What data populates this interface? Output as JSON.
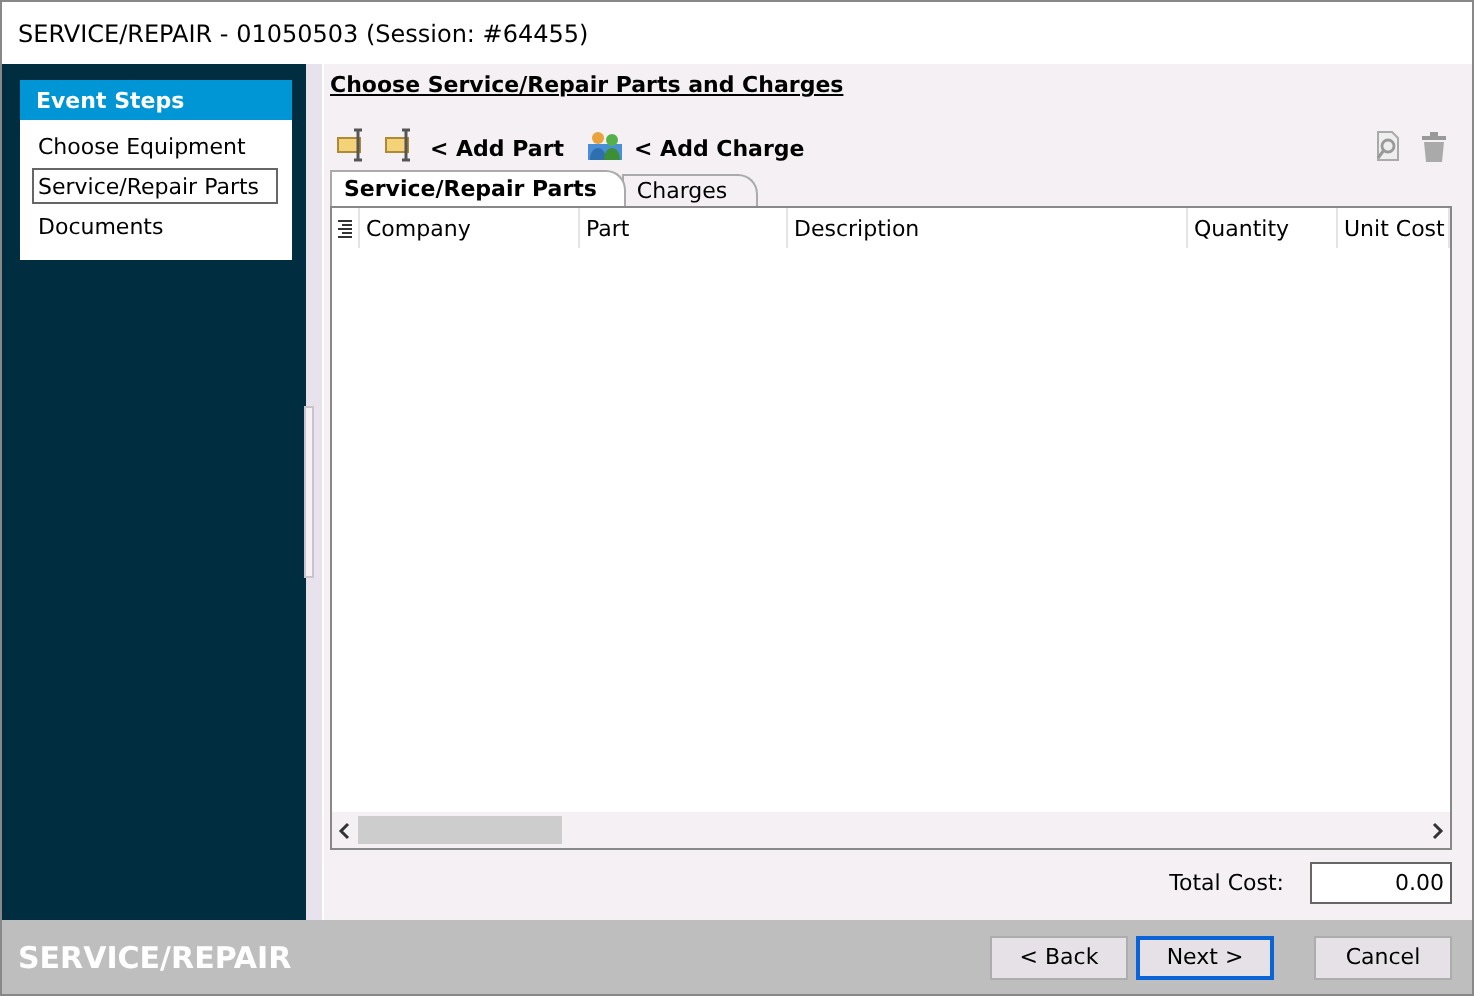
{
  "window": {
    "title": "SERVICE/REPAIR - 01050503 (Session: #64455)"
  },
  "sidebar": {
    "header": "Event Steps",
    "items": [
      {
        "label": "Choose Equipment",
        "selected": false
      },
      {
        "label": "Service/Repair Parts",
        "selected": true
      },
      {
        "label": "Documents",
        "selected": false
      }
    ]
  },
  "heading": "Choose Service/Repair Parts and Charges",
  "toolbar": {
    "add_part": "< Add Part",
    "add_charge": "< Add Charge"
  },
  "tabs": [
    {
      "label": "Service/Repair Parts",
      "selected": true
    },
    {
      "label": "Charges",
      "selected": false
    }
  ],
  "table": {
    "columns": [
      "Company",
      "Part",
      "Description",
      "Quantity",
      "Unit Cost"
    ]
  },
  "total": {
    "label": "Total Cost:",
    "value": "0.00"
  },
  "footer": {
    "title": "SERVICE/REPAIR",
    "buttons": [
      {
        "label": "< Back",
        "default": false
      },
      {
        "label": "Next >",
        "default": true
      },
      {
        "label": "Cancel",
        "default": false
      }
    ]
  }
}
